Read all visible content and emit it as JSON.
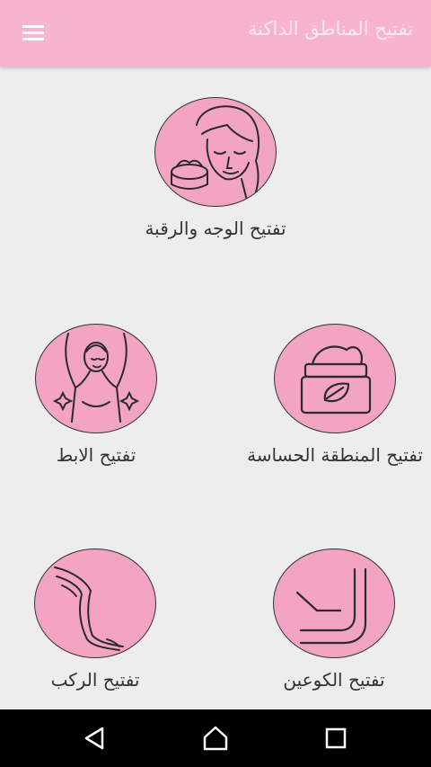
{
  "app_bar": {
    "title": "تفتيح المناطق الداكنة",
    "menu_icon": "hamburger-menu-icon"
  },
  "categories": [
    {
      "label": "تفتيح الوجه والرقبة",
      "icon": "face-cream-icon"
    },
    {
      "label": "تفتيح الابط",
      "icon": "underarm-icon"
    },
    {
      "label": "تفتيح المنطقة الحساسة",
      "icon": "cream-jar-leaf-icon"
    },
    {
      "label": "تفتيح الركب",
      "icon": "legs-knees-icon"
    },
    {
      "label": "تفتيح الكوعين",
      "icon": "elbow-icon"
    }
  ],
  "nav_bar": {
    "back_icon": "back-triangle-icon",
    "home_icon": "home-icon",
    "recents_icon": "recents-square-icon"
  },
  "colors": {
    "app_bar": "#f7b3cf",
    "circle": "#f4a4c3",
    "background": "#ededed",
    "nav_bar": "#000000"
  }
}
